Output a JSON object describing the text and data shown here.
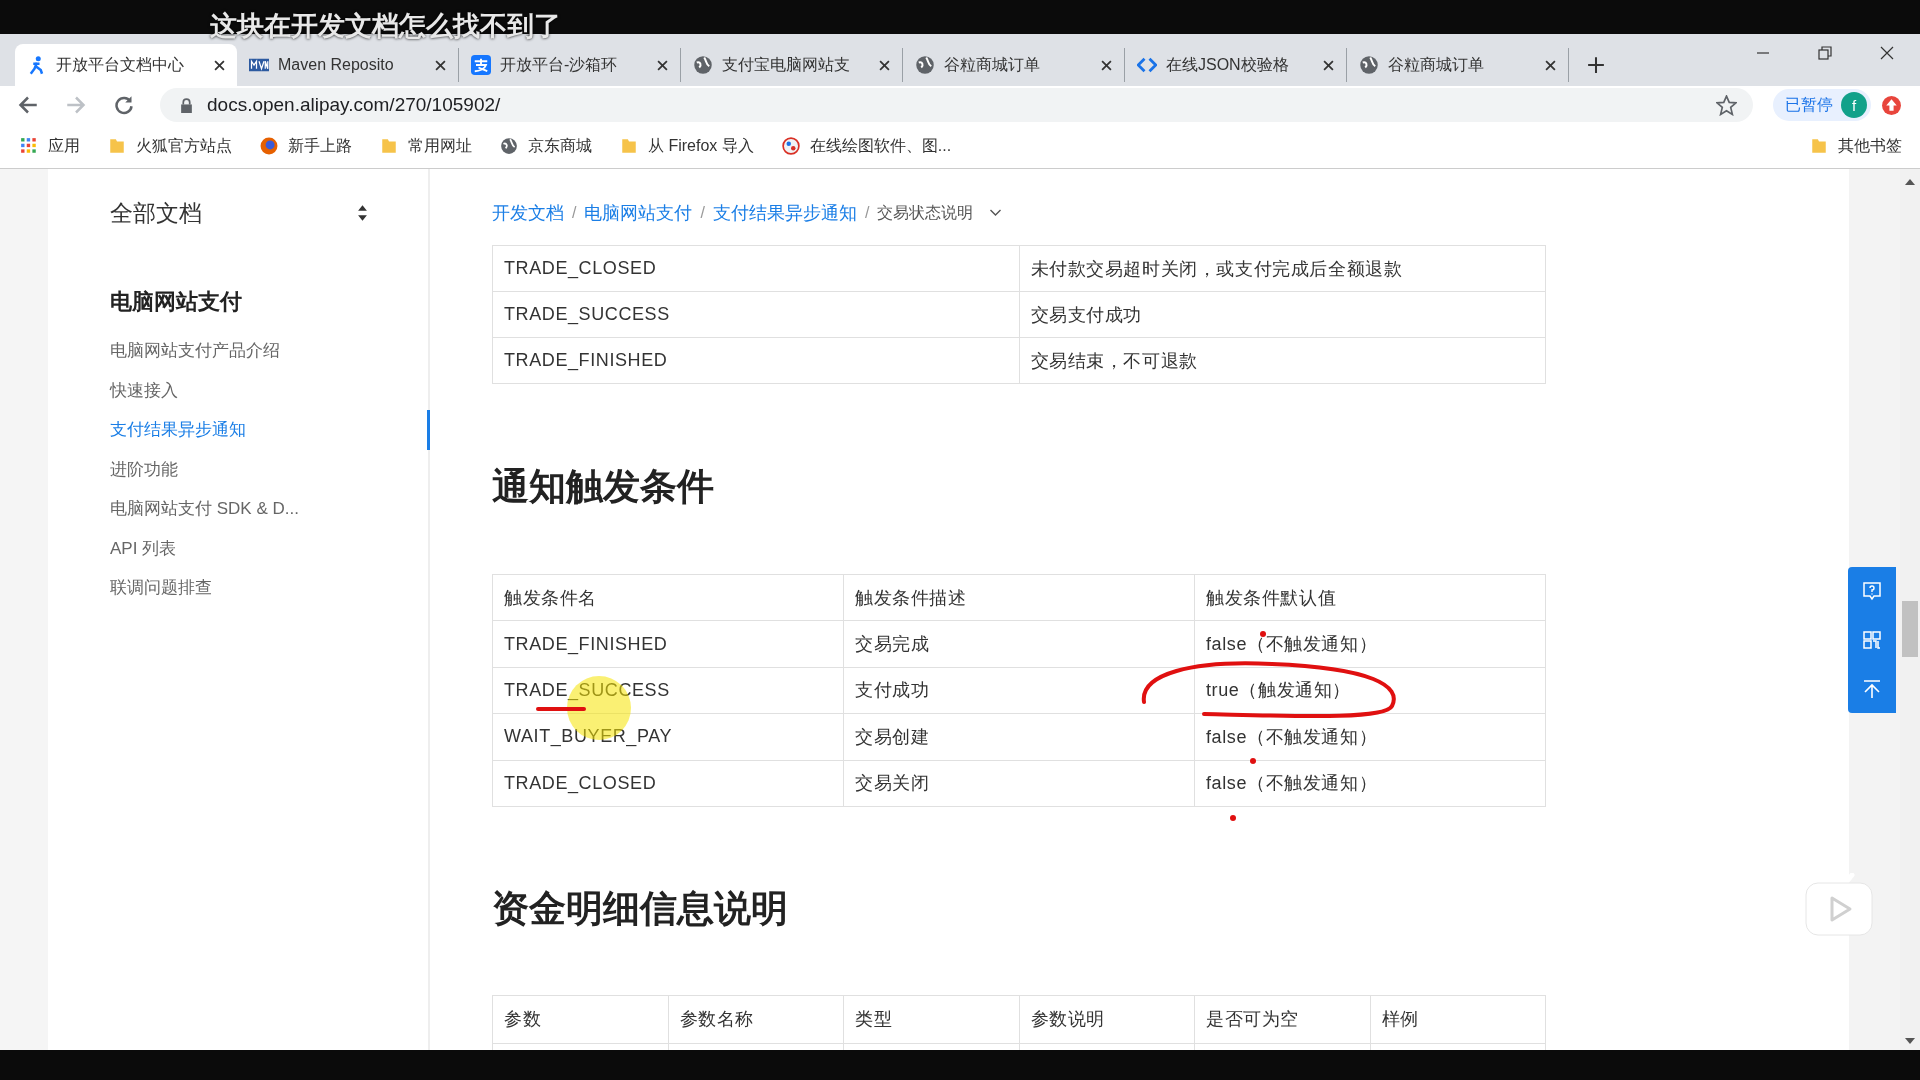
{
  "caption": "这块在开发文档怎么找不到了",
  "tabs": [
    {
      "title": "开放平台文档中心",
      "kind": "runner",
      "selected": true
    },
    {
      "title": "Maven Reposito",
      "kind": "mvn",
      "selected": false
    },
    {
      "title": "开放平台-沙箱环",
      "kind": "alipay",
      "selected": false
    },
    {
      "title": "支付宝电脑网站支",
      "kind": "globe",
      "selected": false
    },
    {
      "title": "谷粒商城订单",
      "kind": "globe",
      "selected": false
    },
    {
      "title": "在线JSON校验格",
      "kind": "json",
      "selected": false
    },
    {
      "title": "谷粒商城订单",
      "kind": "globe",
      "selected": false
    }
  ],
  "address_bar": {
    "url": "docs.open.alipay.com/270/105902/"
  },
  "profile": {
    "status": "已暂停",
    "avatar": "f"
  },
  "bookmarks": [
    {
      "label": "应用",
      "kind": "apps"
    },
    {
      "label": "火狐官方站点",
      "kind": "folder"
    },
    {
      "label": "新手上路",
      "kind": "firefox"
    },
    {
      "label": "常用网址",
      "kind": "folder"
    },
    {
      "label": "京东商城",
      "kind": "globe"
    },
    {
      "label": "从 Firefox 导入",
      "kind": "folder"
    },
    {
      "label": "在线绘图软件、图...",
      "kind": "draw"
    }
  ],
  "other_bookmarks": "其他书签",
  "sidebar": {
    "title": "全部文档",
    "section": "电脑网站支付",
    "items": [
      {
        "label": "电脑网站支付产品介绍",
        "selected": false
      },
      {
        "label": "快速接入",
        "selected": false
      },
      {
        "label": "支付结果异步通知",
        "selected": true
      },
      {
        "label": "进阶功能",
        "selected": false
      },
      {
        "label": "电脑网站支付 SDK & D...",
        "selected": false
      },
      {
        "label": "API 列表",
        "selected": false
      },
      {
        "label": "联调问题排查",
        "selected": false
      }
    ]
  },
  "breadcrumb_separator": "/",
  "breadcrumb": [
    {
      "label": "开发文档",
      "kind": "link"
    },
    {
      "label": "电脑网站支付",
      "kind": "link"
    },
    {
      "label": "支付结果异步通知",
      "kind": "link"
    },
    {
      "label": "交易状态说明",
      "kind": "current"
    }
  ],
  "status_table": {
    "rows": [
      [
        "TRADE_CLOSED",
        "未付款交易超时关闭，或支付完成后全额退款"
      ],
      [
        "TRADE_SUCCESS",
        "交易支付成功"
      ],
      [
        "TRADE_FINISHED",
        "交易结束，不可退款"
      ]
    ]
  },
  "trigger_section": {
    "heading": "通知触发条件",
    "columns": [
      "触发条件名",
      "触发条件描述",
      "触发条件默认值"
    ],
    "rows": [
      [
        "TRADE_FINISHED",
        "交易完成",
        "false（不触发通知）"
      ],
      [
        "TRADE_SUCCESS",
        "支付成功",
        "true（触发通知）"
      ],
      [
        "WAIT_BUYER_PAY",
        "交易创建",
        "false（不触发通知）"
      ],
      [
        "TRADE_CLOSED",
        "交易关闭",
        "false（不触发通知）"
      ]
    ]
  },
  "fund_section": {
    "heading": "资金明细信息说明",
    "columns": [
      "参数",
      "参数名称",
      "类型",
      "参数说明",
      "是否可为空",
      "样例"
    ]
  }
}
